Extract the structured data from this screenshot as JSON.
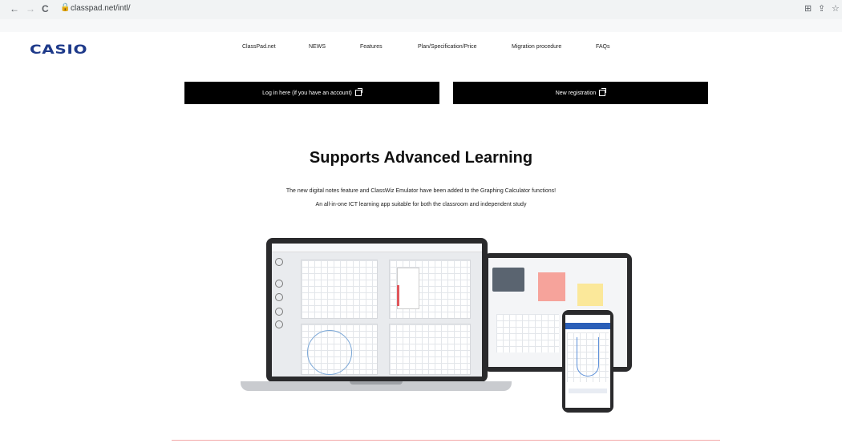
{
  "browser": {
    "url": "classpad.net/intl/",
    "back_icon": "←",
    "forward_icon": "→",
    "reload_icon": "C"
  },
  "header": {
    "logo": "CASIO",
    "menu": [
      "ClassPad.net",
      "NEWS",
      "Features",
      "Plan/Specification/Price",
      "Migration procedure",
      "FAQs"
    ]
  },
  "cta": {
    "login": "Log in here (if you have an account)",
    "register": "New registration"
  },
  "hero": {
    "title": "Supports Advanced Learning",
    "line1": "The new digital notes feature and ClassWiz Emulator have been added to the Graphing Calculator functions!",
    "line2": "An all-in-one ICT learning app suitable for both the classroom and independent study"
  },
  "colors": {
    "logo": "#1e3a8a",
    "button_bg": "#000000",
    "note_pink": "#f6a39b",
    "note_yellow": "#fbe89a"
  }
}
